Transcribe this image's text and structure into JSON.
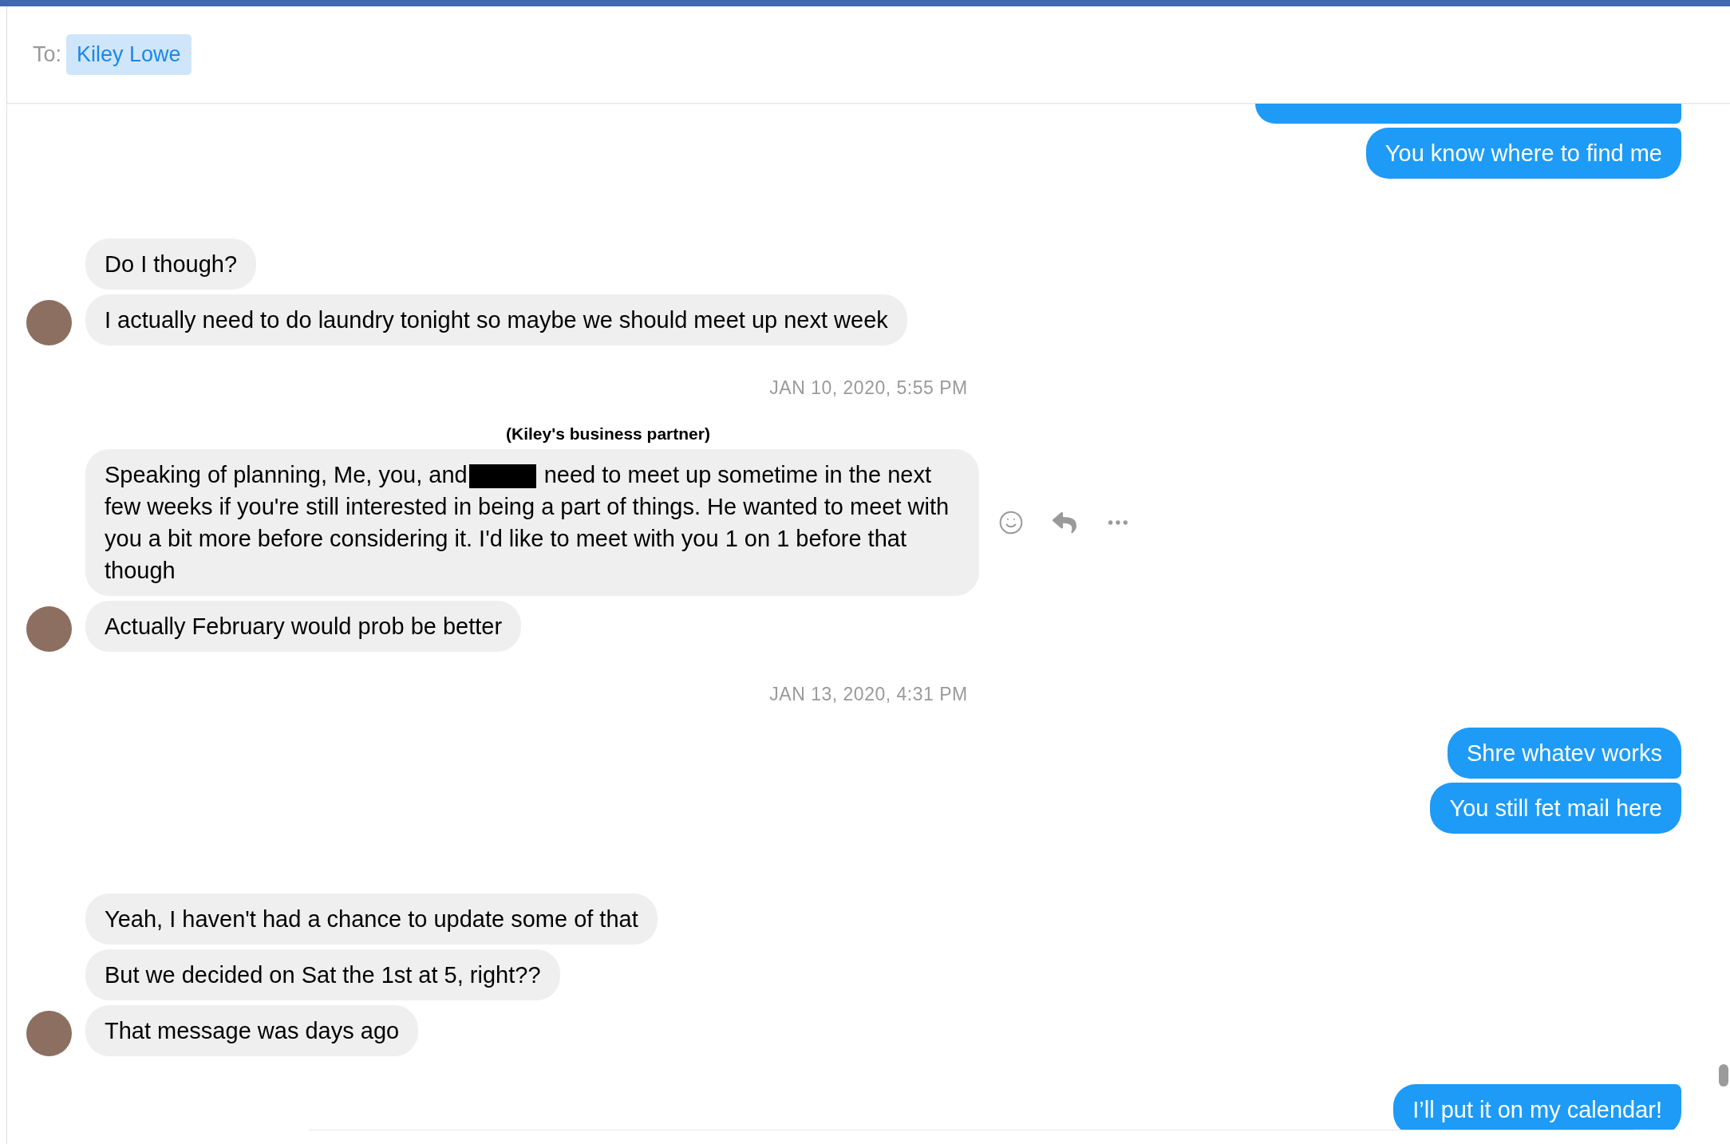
{
  "header": {
    "to_label": "To:",
    "recipient": "Kiley Lowe"
  },
  "items": [
    {
      "kind": "outgoing",
      "messages": [
        {
          "text": "You know where to find me"
        }
      ]
    },
    {
      "kind": "incoming",
      "messages": [
        {
          "text": "Do I though?"
        },
        {
          "text": "I actually need to do laundry tonight so maybe we should meet up next week"
        }
      ]
    },
    {
      "kind": "timestamp",
      "text": "JAN 10, 2020, 5:55 PM"
    },
    {
      "kind": "incoming",
      "note": "(Kiley's business partner)",
      "messages": [
        {
          "text": "Speaking of planning, Me, you, and",
          "redacted": true,
          "text_after": "need to meet up sometime in the next few weeks if you're still interested in being a part of things. He wanted to meet with you a bit more before considering it. I'd like to meet with you 1 on 1 before that though",
          "hovered": true
        },
        {
          "text": "Actually February would prob be better"
        }
      ]
    },
    {
      "kind": "timestamp",
      "text": "JAN 13, 2020, 4:31 PM"
    },
    {
      "kind": "outgoing",
      "messages": [
        {
          "text": "Shre whatev works"
        },
        {
          "text": "You still fet mail here"
        }
      ]
    },
    {
      "kind": "incoming",
      "messages": [
        {
          "text": "Yeah, I haven't had a chance to update some of that"
        },
        {
          "text": "But we decided on Sat the 1st at 5, right??"
        },
        {
          "text": "That message was days ago"
        }
      ]
    },
    {
      "kind": "outgoing",
      "messages": [
        {
          "text": "I’ll put it on my calendar!"
        }
      ]
    }
  ]
}
